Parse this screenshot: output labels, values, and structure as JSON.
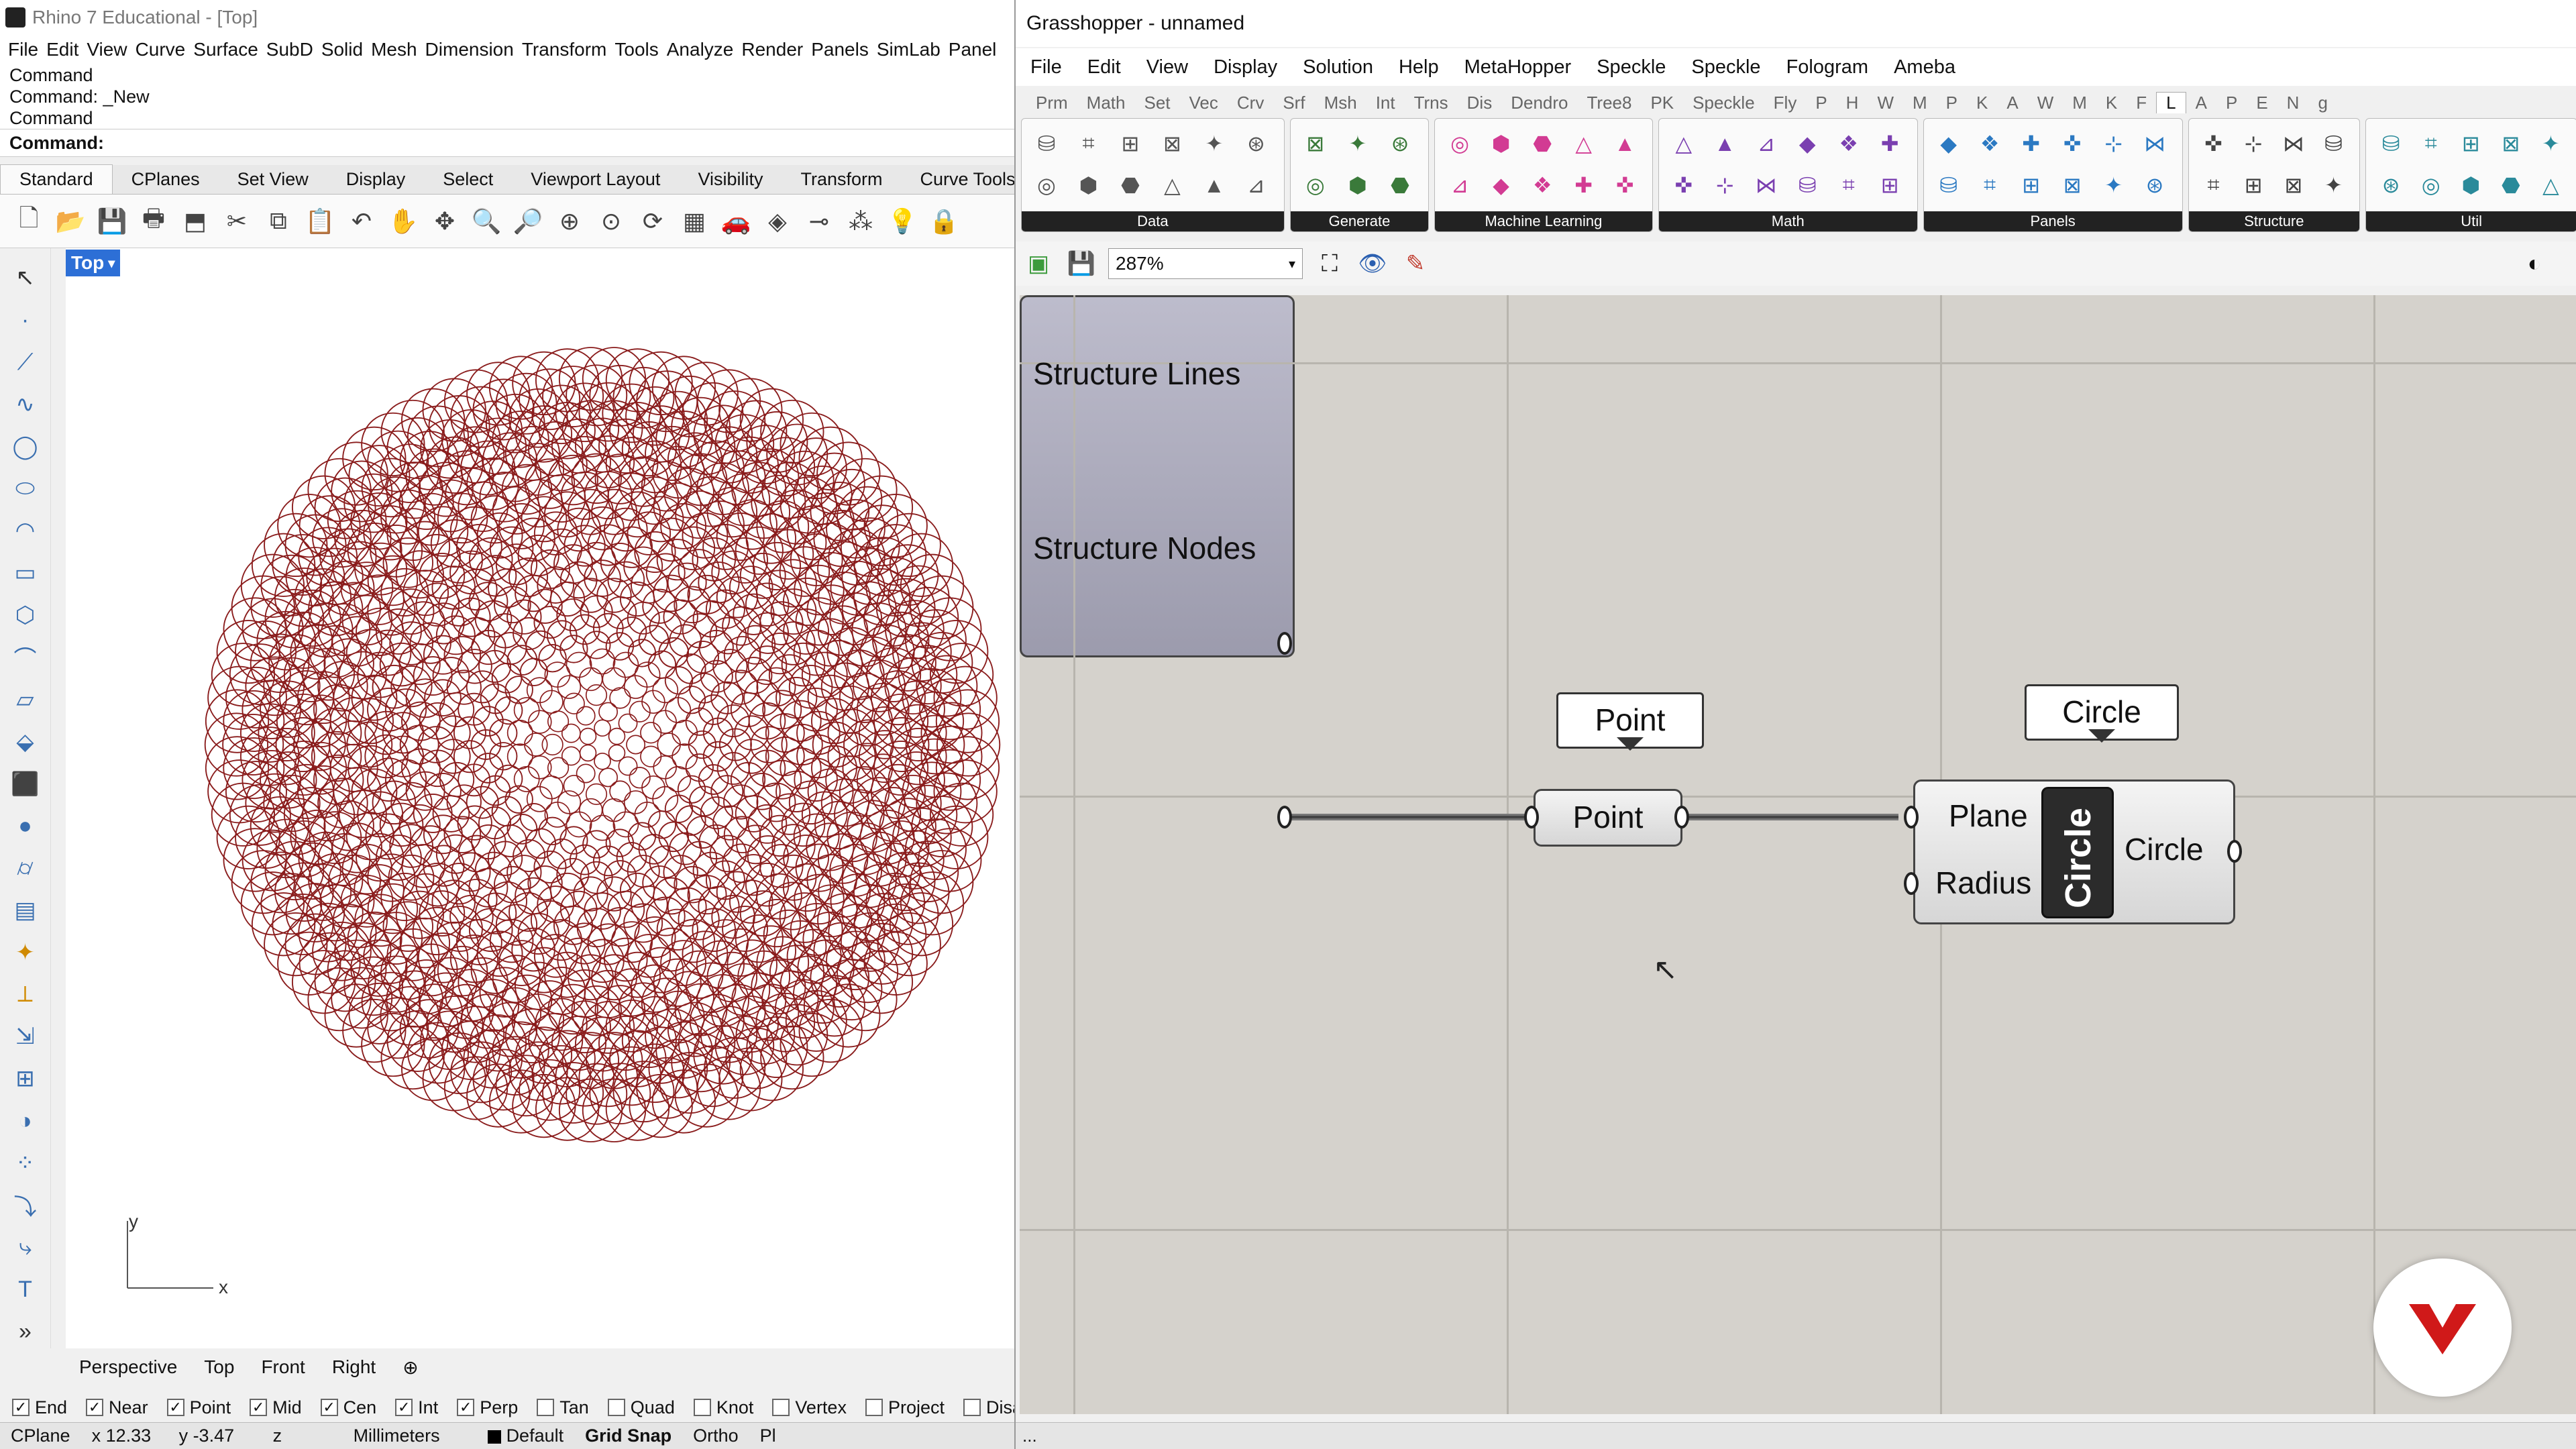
{
  "rhino": {
    "title": "Rhino 7 Educational - [Top]",
    "menu": [
      "File",
      "Edit",
      "View",
      "Curve",
      "Surface",
      "SubD",
      "Solid",
      "Mesh",
      "Dimension",
      "Transform",
      "Tools",
      "Analyze",
      "Render",
      "Panels",
      "SimLab",
      "Panel"
    ],
    "command_history": [
      "Command",
      "Command: _New",
      "Command"
    ],
    "command_prompt": "Command:",
    "toolbar_tabs": [
      "Standard",
      "CPlanes",
      "Set View",
      "Display",
      "Select",
      "Viewport Layout",
      "Visibility",
      "Transform",
      "Curve Tools"
    ],
    "viewport_label": "Top",
    "axis_y": "y",
    "axis_x": "x",
    "viewport_tabs": [
      "Perspective",
      "Top",
      "Front",
      "Right"
    ],
    "osnaps": [
      {
        "label": "End",
        "checked": true
      },
      {
        "label": "Near",
        "checked": true
      },
      {
        "label": "Point",
        "checked": true
      },
      {
        "label": "Mid",
        "checked": true
      },
      {
        "label": "Cen",
        "checked": true
      },
      {
        "label": "Int",
        "checked": true
      },
      {
        "label": "Perp",
        "checked": true
      },
      {
        "label": "Tan",
        "checked": false
      },
      {
        "label": "Quad",
        "checked": false
      },
      {
        "label": "Knot",
        "checked": false
      },
      {
        "label": "Vertex",
        "checked": false
      },
      {
        "label": "Project",
        "checked": false
      },
      {
        "label": "Disable",
        "checked": false
      }
    ],
    "status": {
      "cplane": "CPlane",
      "x": "x 12.33",
      "y": "y -3.47",
      "z": "z",
      "units": "Millimeters",
      "layer": "Default",
      "grid_snap": "Grid Snap",
      "ortho": "Ortho",
      "pl": "Pl"
    },
    "mandala_color": "#8a1c1c"
  },
  "gh": {
    "title": "Grasshopper - unnamed",
    "menu": [
      "File",
      "Edit",
      "View",
      "Display",
      "Solution",
      "Help",
      "MetaHopper",
      "Speckle",
      "Speckle",
      "Fologram",
      "Ameba"
    ],
    "categories": [
      "Prm",
      "Math",
      "Set",
      "Vec",
      "Crv",
      "Srf",
      "Msh",
      "Int",
      "Trns",
      "Dis",
      "Dendro",
      "Tree8",
      "PK",
      "Speckle",
      "Fly",
      "P",
      "H",
      "W",
      "M",
      "P",
      "K",
      "A",
      "W",
      "M",
      "K",
      "F",
      "L",
      "A",
      "P",
      "E",
      "N",
      "g"
    ],
    "active_category": "L",
    "panels": [
      "Data",
      "Generate",
      "Machine Learning",
      "Math",
      "Panels",
      "Structure",
      "Util"
    ],
    "zoom": "287%",
    "canvas_bg": "#d5d2cc",
    "components": {
      "structure_lines": "Structure Lines",
      "structure_nodes": "Structure Nodes",
      "point_bubble": "Point",
      "point_param": "Point",
      "circle_bubble": "Circle",
      "circle_plane": "Plane",
      "circle_radius": "Radius",
      "circle_name": "Circle",
      "circle_out": "Circle"
    },
    "status": "..."
  }
}
